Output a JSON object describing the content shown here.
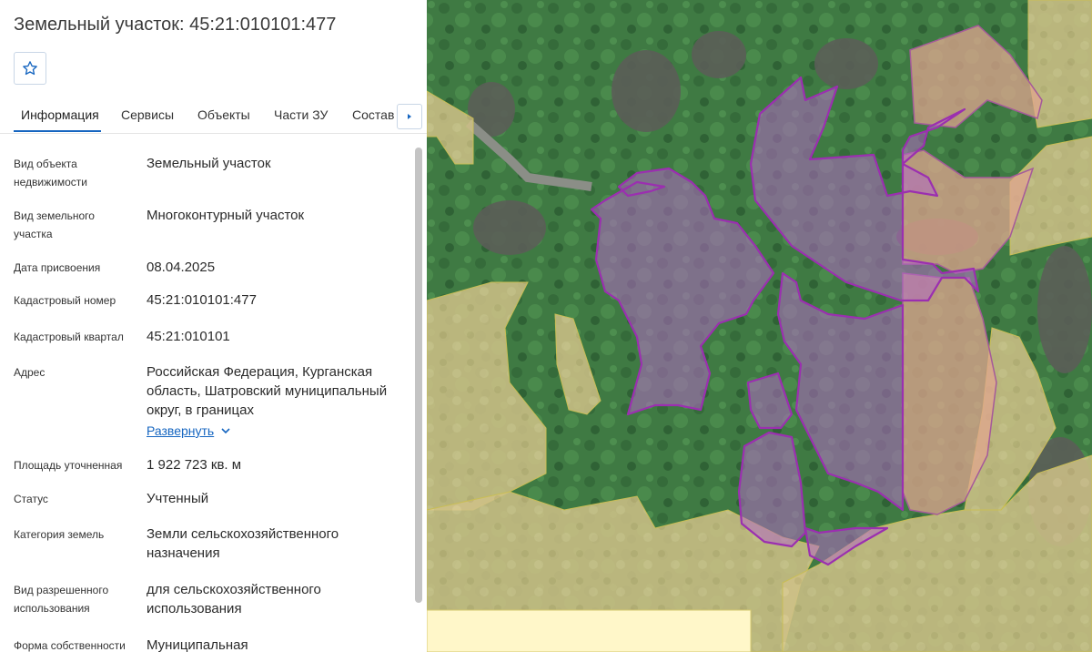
{
  "header": {
    "title": "Земельный участок: 45:21:010101:477"
  },
  "tabs": [
    {
      "label": "Информация",
      "active": true
    },
    {
      "label": "Сервисы"
    },
    {
      "label": "Объекты"
    },
    {
      "label": "Части ЗУ"
    },
    {
      "label": "Состав"
    }
  ],
  "fields": [
    {
      "label": "Вид объекта недвижимости",
      "value": "Земельный участок"
    },
    {
      "label": "Вид земельного участка",
      "value": "Многоконтурный участок"
    },
    {
      "label": "Дата присвоения",
      "value": "08.04.2025"
    },
    {
      "label": "Кадастровый номер",
      "value": "45:21:010101:477"
    },
    {
      "label": "Кадастровый квартал",
      "value": "45:21:010101"
    },
    {
      "label": "Адрес",
      "value": "Российская Федерация, Курганская область, Шатровский муниципальный округ, в границах"
    },
    {
      "label": "Площадь уточненная",
      "value": "1 922 723 кв. м"
    },
    {
      "label": "Статус",
      "value": "Учтенный"
    },
    {
      "label": "Категория земель",
      "value": "Земли сельскохозяйственного назначения"
    },
    {
      "label": "Вид разрешенного использования",
      "value": "для сельскохозяйственного использования"
    },
    {
      "label": "Форма собственности",
      "value": "Муниципальная"
    }
  ],
  "address_expand": {
    "label": "Развернуть"
  },
  "colors": {
    "accent": "#1565c0",
    "forest": "#3f7a43",
    "field_overlay": "#d6c68a",
    "parcel_fill": "#b36ac4",
    "parcel_stroke": "#9b2fb0",
    "orange_parcel": "#e0a58f"
  },
  "icons": {
    "favorite": "star-icon",
    "tabs_next": "chevron-right-icon",
    "expand": "chevron-down-icon"
  }
}
